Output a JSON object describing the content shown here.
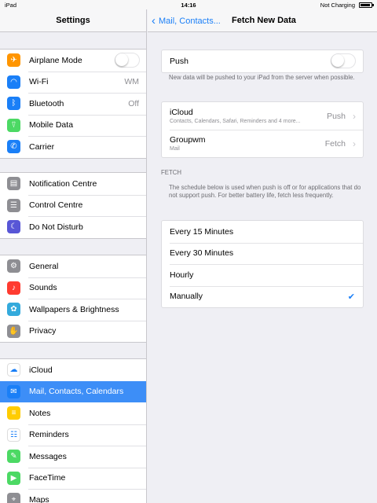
{
  "status": {
    "device": "iPad",
    "time": "14:16",
    "charging": "Not Charging"
  },
  "left": {
    "title": "Settings",
    "groups": [
      [
        {
          "label": "Airplane Mode",
          "icon": "airplane-icon",
          "color": "#ff9500",
          "toggle": true
        },
        {
          "label": "Wi-Fi",
          "icon": "wifi-icon",
          "color": "#1a7ff7",
          "value": "WM"
        },
        {
          "label": "Bluetooth",
          "icon": "bluetooth-icon",
          "color": "#1a7ff7",
          "value": "Off"
        },
        {
          "label": "Mobile Data",
          "icon": "antenna-icon",
          "color": "#4cd964"
        },
        {
          "label": "Carrier",
          "icon": "phone-icon",
          "color": "#1a7ff7"
        }
      ],
      [
        {
          "label": "Notification Centre",
          "icon": "notification-icon",
          "color": "#8e8e93"
        },
        {
          "label": "Control Centre",
          "icon": "control-icon",
          "color": "#8e8e93"
        },
        {
          "label": "Do Not Disturb",
          "icon": "moon-icon",
          "color": "#5856d6"
        }
      ],
      [
        {
          "label": "General",
          "icon": "gear-icon",
          "color": "#8e8e93"
        },
        {
          "label": "Sounds",
          "icon": "speaker-icon",
          "color": "#ff3b30"
        },
        {
          "label": "Wallpapers & Brightness",
          "icon": "flower-icon",
          "color": "#34aadc"
        },
        {
          "label": "Privacy",
          "icon": "hand-icon",
          "color": "#8e8e93"
        }
      ],
      [
        {
          "label": "iCloud",
          "icon": "cloud-icon",
          "color": "#ffffff"
        },
        {
          "label": "Mail, Contacts, Calendars",
          "icon": "mail-icon",
          "color": "#1a7ff7",
          "selected": true
        },
        {
          "label": "Notes",
          "icon": "notes-icon",
          "color": "#ffcc00"
        },
        {
          "label": "Reminders",
          "icon": "list-icon",
          "color": "#ffffff"
        },
        {
          "label": "Messages",
          "icon": "message-icon",
          "color": "#4cd964"
        },
        {
          "label": "FaceTime",
          "icon": "camera-icon",
          "color": "#4cd964"
        },
        {
          "label": "Maps",
          "icon": "map-icon",
          "color": "#8e8e93"
        }
      ]
    ]
  },
  "right": {
    "back_label": "Mail, Contacts...",
    "title": "Fetch New Data",
    "push_label": "Push",
    "push_note": "New data will be pushed to your iPad from the server when possible.",
    "accounts": [
      {
        "name": "iCloud",
        "detail": "Contacts, Calendars, Safari, Reminders and 4 more...",
        "value": "Push"
      },
      {
        "name": "Groupwm",
        "detail": "Mail",
        "value": "Fetch"
      }
    ],
    "fetch_header": "FETCH",
    "fetch_note": "The schedule below is used when push is off or for applications that do not support push. For better battery life, fetch less frequently.",
    "options": [
      {
        "label": "Every 15 Minutes",
        "checked": false
      },
      {
        "label": "Every 30 Minutes",
        "checked": false
      },
      {
        "label": "Hourly",
        "checked": false
      },
      {
        "label": "Manually",
        "checked": true
      }
    ]
  }
}
